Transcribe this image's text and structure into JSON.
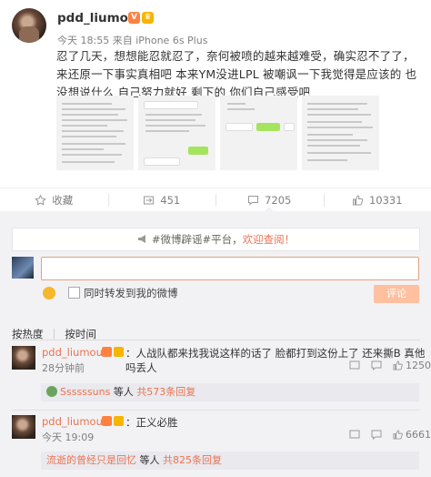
{
  "post": {
    "username": "pdd_liumou",
    "meta": "今天 18:55 来自 iPhone 6s Plus",
    "text": "忍了几天，想想能忍就忍了，奈何被喷的越来越难受，确实忍不了了，来还原一下事实真相吧 本来YM没进LPL 被嘲讽一下我觉得是应该的 也没想说什么 自己努力就好 剩下的 你们自己感受吧",
    "actions": {
      "favorite": "收藏",
      "repost": "451",
      "comments": "7205",
      "likes": "10331"
    }
  },
  "comment_area": {
    "notice_prefix": "#微博辟谣#平台，",
    "notice_link": "欢迎查阅！",
    "repost_option": "同时转发到我的微博",
    "submit_label": "评论",
    "sort_hot": "按热度",
    "sort_time": "按时间"
  },
  "comments": [
    {
      "name": "pdd_liumou",
      "text": "：人战队都来找我说这样的话了 脸都打到这份上了 还来撕B 真他吗丢人",
      "time": "28分钟前",
      "likes": "1250",
      "reply_who": "Ssssssuns",
      "reply_mid": " 等人 ",
      "reply_count": "共573条回复"
    },
    {
      "name": "pdd_liumou",
      "text": "：正义必胜",
      "time": "今天 19:09",
      "likes": "6661",
      "reply_who": "流逝的曾经只是回忆",
      "reply_mid": " 等人 ",
      "reply_count": "共825条回复"
    }
  ],
  "colors": {
    "accent": "#eb7350",
    "background": "#f2f2f5"
  }
}
